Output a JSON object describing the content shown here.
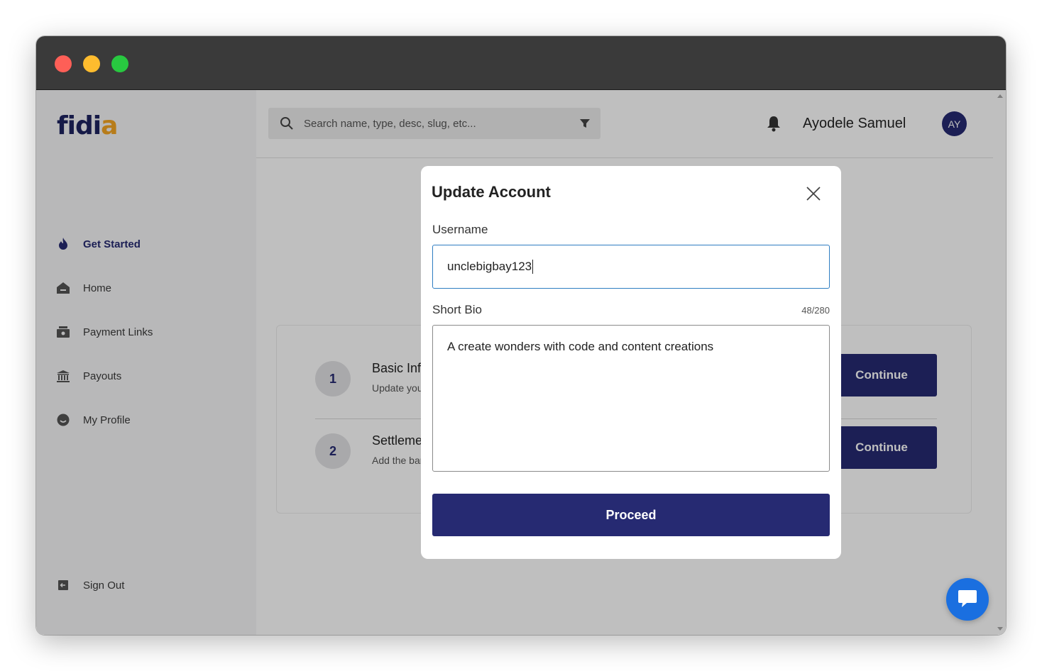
{
  "app": {
    "logo": "fidia"
  },
  "sidebar": {
    "items": [
      {
        "label": "Get Started",
        "icon": "flame-icon",
        "active": true
      },
      {
        "label": "Home",
        "icon": "home-icon",
        "active": false
      },
      {
        "label": "Payment Links",
        "icon": "register-icon",
        "active": false
      },
      {
        "label": "Payouts",
        "icon": "bank-icon",
        "active": false
      },
      {
        "label": "My Profile",
        "icon": "smile-icon",
        "active": false
      }
    ],
    "signout": "Sign Out"
  },
  "header": {
    "search_placeholder": "Search name, type, desc, slug, etc...",
    "user_name": "Ayodele Samuel",
    "avatar_initials": "AY"
  },
  "steps": [
    {
      "number": "1",
      "title": "Basic Info",
      "description": "Update your",
      "button": "Continue"
    },
    {
      "number": "2",
      "title": "Settlement",
      "description": "Add the bank",
      "button": "Continue"
    }
  ],
  "modal": {
    "title": "Update Account",
    "username_label": "Username",
    "username_value": "unclebigbay123",
    "bio_label": "Short Bio",
    "bio_counter": "48/280",
    "bio_value": "A create wonders with code and content creations",
    "proceed_label": "Proceed"
  },
  "colors": {
    "brand": "#262a72",
    "accent": "#f5a623",
    "chat": "#1a6fe0",
    "input_focus": "#2e7dc2"
  }
}
